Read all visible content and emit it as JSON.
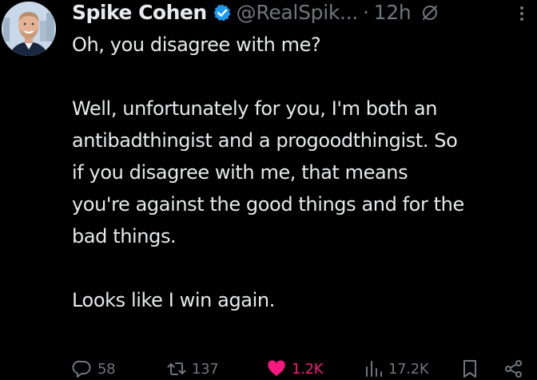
{
  "author": {
    "display_name": "Spike Cohen",
    "handle": "@RealSpik...",
    "separator": "·",
    "time": "12h",
    "verified": true,
    "verified_color": "#1d9bf0"
  },
  "tweet": {
    "lines": [
      "Oh, you disagree with me?",
      "",
      "Well, unfortunately for you, I'm both an",
      "antibadthingist and a progoodthingist. So",
      "if you disagree with me, that means",
      "you're against the good things and for the",
      "bad things.",
      "",
      "Looks like I win again."
    ]
  },
  "actions": {
    "replies": "58",
    "reposts": "137",
    "likes": "1.2K",
    "views": "17.2K",
    "like_color": "#f91880",
    "muted_color": "#71767b"
  },
  "icons": {
    "avatar": "avatar",
    "verified": "verified-badge-icon",
    "grok": "grok-icon",
    "more": "more-icon",
    "reply": "reply-icon",
    "repost": "repost-icon",
    "like": "heart-icon",
    "views": "views-icon",
    "bookmark": "bookmark-icon",
    "share": "share-icon"
  }
}
